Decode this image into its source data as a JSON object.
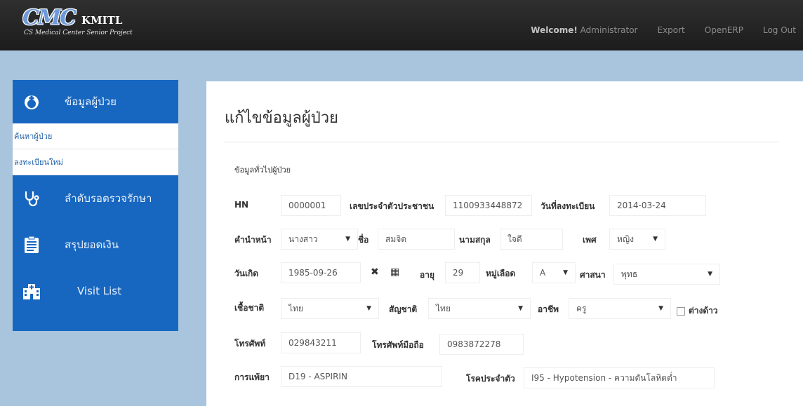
{
  "navbar": {
    "logo_mark": "CMC",
    "logo_kmitl": "KMITL",
    "logo_sub": "CS Medical Center Senior Project",
    "welcome_prefix": "Welcome!",
    "welcome_user": "Administrator",
    "links": [
      "Export",
      "OpenERP",
      "Log Out"
    ]
  },
  "sidebar": {
    "patient_info": "ข้อมูลผู้ป่วย",
    "sub_items": [
      "ค้นหาผู้ป่วย",
      "ลงทะเบียนใหม่"
    ],
    "queue": "ลำดับรอตรวจรักษา",
    "summary": "สรุปยอดเงิน",
    "visit_list": "Visit List"
  },
  "main": {
    "title": "แก้ไขข้อมูลผู้ป่วย",
    "section": "ข้อมูลทั่วไปผู้ป่วย"
  },
  "form": {
    "hn_label": "HN",
    "hn": "0000001",
    "citizen_id_label": "เลขประจำตัวประชาชน",
    "citizen_id": "1100933448872",
    "register_date_label": "วันที่ลงทะเบียน",
    "register_date": "2014-03-24",
    "prefix_label": "คำนำหน้า",
    "prefix": "นางสาว",
    "first_name_label": "ชื่อ",
    "first_name": "สมจิต",
    "last_name_label": "นามสกุล",
    "last_name": "ใจดี",
    "sex_label": "เพศ",
    "sex": "หญิง",
    "birthdate_label": "วันเกิด",
    "birthdate": "1985-09-26",
    "age_label": "อายุ",
    "age": "29",
    "blood_label": "หมู่เลือด",
    "blood": "A",
    "religion_label": "ศาสนา",
    "religion": "พุทธ",
    "ethnicity_label": "เชื้อชาติ",
    "ethnicity": "ไทย",
    "nationality_label": "สัญชาติ",
    "nationality": "ไทย",
    "occupation_label": "อาชีพ",
    "occupation": "ครู",
    "foreigner_label": "ต่างด้าว",
    "phone_label": "โทรศัพท์",
    "phone": "029843211",
    "mobile_label": "โทรศัพท์มือถือ",
    "mobile": "0983872278",
    "allergy_label": "การแพ้ยา",
    "allergy": "D19 - ASPIRIN",
    "disease_label": "โรคประจำตัว",
    "disease": "I95 - Hypotension - ความดันโลหิตต่ำ"
  },
  "colors": {
    "sidebar_blue": "#1767c0",
    "background": "#a9c4dd",
    "navbar": "#262626"
  }
}
